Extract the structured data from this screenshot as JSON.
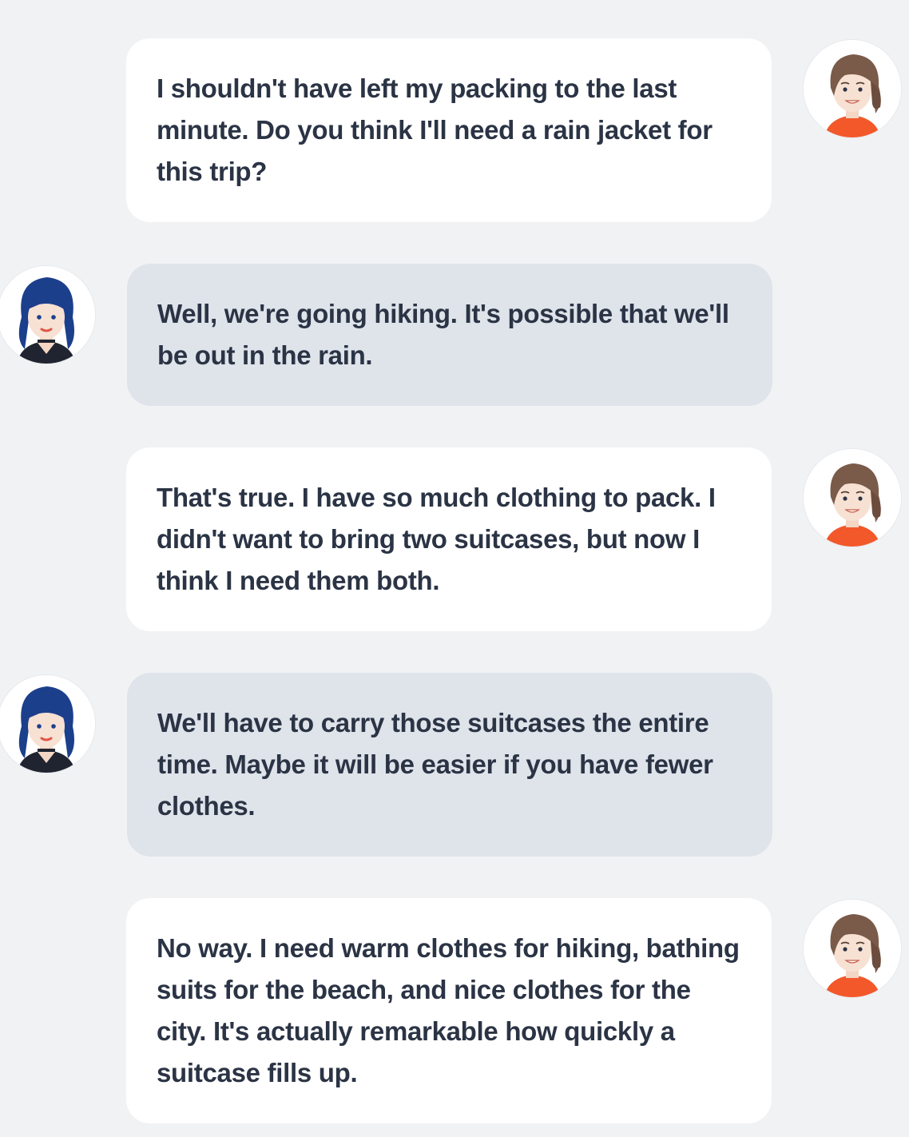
{
  "conversation": {
    "messages": [
      {
        "speaker": "self",
        "avatar": "brown-hair-woman-avatar",
        "text": "I shouldn't have left my packing to the last minute. Do you think I'll need a rain jacket for this trip?"
      },
      {
        "speaker": "other",
        "avatar": "blue-hair-woman-avatar",
        "text": "Well, we're going hiking. It's possible that we'll be out in the rain."
      },
      {
        "speaker": "self",
        "avatar": "brown-hair-woman-avatar",
        "text": "That's true. I have so much clothing to pack. I didn't want to bring two suitcases, but now I think I need them both."
      },
      {
        "speaker": "other",
        "avatar": "blue-hair-woman-avatar",
        "text": "We'll have to carry those suitcases the entire time. Maybe it will be easier if you have fewer clothes."
      },
      {
        "speaker": "self",
        "avatar": "brown-hair-woman-avatar",
        "text": "No way. I need warm clothes for hiking, bathing suits for the beach, and nice clothes for the city. It's actually remarkable how quickly a suitcase fills up."
      }
    ]
  },
  "colors": {
    "background": "#f1f2f4",
    "self_bubble": "#ffffff",
    "other_bubble": "#dfe3ea",
    "text": "#2b3445",
    "self_shirt": "#f2582a",
    "self_hair": "#7a5a49",
    "other_hair": "#1c3f8c"
  }
}
